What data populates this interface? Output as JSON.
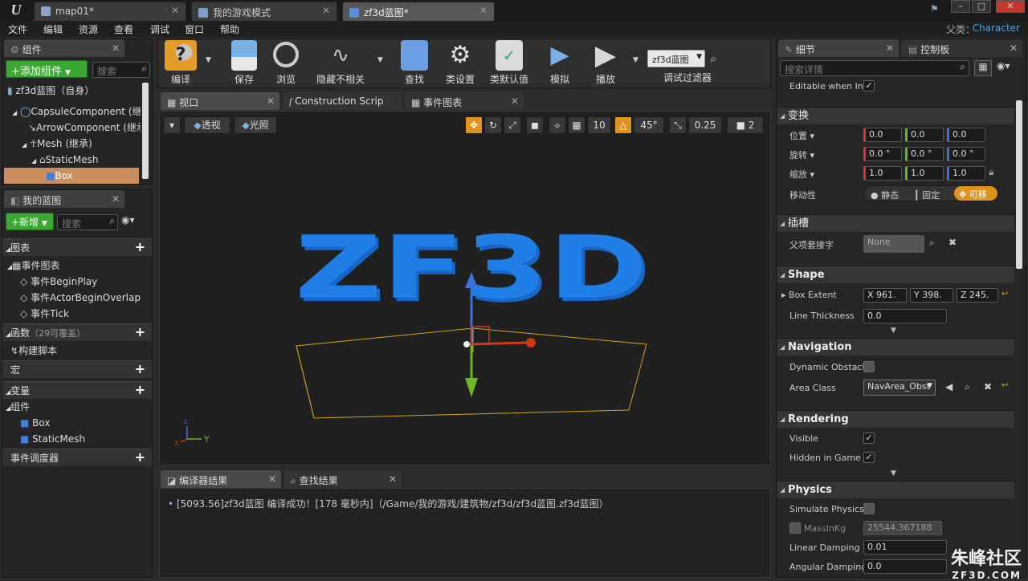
{
  "title_bar": {
    "logo": "U",
    "tabs": [
      {
        "label": "map01*",
        "active": false
      },
      {
        "label": "我的游戏模式",
        "active": false
      },
      {
        "label": "zf3d蓝图*",
        "active": true
      }
    ]
  },
  "menu": [
    "文件",
    "编辑",
    "资源",
    "查看",
    "调试",
    "窗口",
    "帮助"
  ],
  "parent_class": {
    "label": "父类：",
    "value": "Character"
  },
  "components_panel": {
    "tab": "组件",
    "add_button": "+添加组件",
    "search_placeholder": "搜索",
    "self_item": "zf3d蓝图（自身）",
    "tree": [
      "CapsuleComponent (继承)",
      "ArrowComponent (继承)",
      "Mesh (继承)",
      "StaticMesh",
      "Box"
    ]
  },
  "my_blueprint": {
    "tab": "我的蓝图",
    "new_button": "+新增",
    "search_placeholder": "搜索",
    "graphs_header": "图表",
    "event_graph": "事件图表",
    "events": [
      "事件BeginPlay",
      "事件ActorBeginOverlap",
      "事件Tick"
    ],
    "functions_header": "函数",
    "functions_count": "（29可覆盖）",
    "construction_script": "构建脚本",
    "macros_header": "宏",
    "variables_header": "变量",
    "components_header": "组件",
    "component_vars": [
      "Box",
      "StaticMesh"
    ],
    "dispatchers_header": "事件调度器"
  },
  "toolbar": {
    "buttons": [
      "编译",
      "保存",
      "浏览",
      "隐藏不相关",
      "查找",
      "类设置",
      "类默认值",
      "模拟",
      "播放"
    ],
    "debug_object": "zf3d蓝图",
    "debug_filter_label": "调试过滤器",
    "colors": {
      "compile": "#e59b27",
      "blue": "#4a90d9"
    }
  },
  "editor_tabs": [
    "视口",
    "Construction Scrip",
    "事件图表"
  ],
  "viewport_toolbar": {
    "perspective": "透视",
    "lit": "光照",
    "grid_snap": "10",
    "rotation_snap": "45°",
    "scale_snap": "0.25",
    "camera_speed": "2"
  },
  "viewport": {
    "text_3d": "ZF3D",
    "axis_x": "X",
    "axis_y": "Y",
    "text_color": "#1f7fe6"
  },
  "bottom_tabs": [
    "编译器结果",
    "查找结果"
  ],
  "compiler_message": "[5093.56]zf3d蓝图 编译成功！[178 毫秒内]（/Game/我的游戏/建筑物/zf3d/zf3d蓝图.zf3d蓝图）",
  "details_panel": {
    "tabs": [
      "细节",
      "控制板"
    ],
    "search_placeholder": "搜索详情",
    "editable_label": "Editable when Inh",
    "transform": {
      "header": "变换",
      "location_label": "位置",
      "location": [
        "0.0",
        "0.0",
        "0.0"
      ],
      "rotation_label": "旋转",
      "rotation": [
        "0.0 °",
        "0.0 °",
        "0.0 °"
      ],
      "scale_label": "缩放",
      "scale": [
        "1.0",
        "1.0",
        "1.0"
      ],
      "mobility_label": "移动性",
      "mobility_options": [
        "静态",
        "固定",
        "可移"
      ]
    },
    "sockets": {
      "header": "插槽",
      "parent_socket_label": "父项套接字",
      "parent_socket_value": "None"
    },
    "shape": {
      "header": "Shape",
      "box_extent_label": "Box Extent",
      "box_extent": [
        "X  961.",
        "Y  398.",
        "Z  245."
      ],
      "line_thickness_label": "Line Thickness",
      "line_thickness": "0.0"
    },
    "navigation": {
      "header": "Navigation",
      "dynamic_obstacle_label": "Dynamic Obstacl",
      "area_class_label": "Area Class",
      "area_class_value": "NavArea_Obst"
    },
    "rendering": {
      "header": "Rendering",
      "visible_label": "Visible",
      "hidden_in_game_label": "Hidden in Game"
    },
    "physics": {
      "header": "Physics",
      "simulate_label": "Simulate Physics",
      "mass_label": "MassInKg",
      "mass_value": "25544.367188",
      "linear_damping_label": "Linear Damping",
      "linear_damping": "0.01",
      "angular_damping_label": "Angular Damping",
      "angular_damping": "0.0"
    }
  },
  "watermark": {
    "main": "朱峰社区",
    "sub": "ZF3D.COM"
  }
}
